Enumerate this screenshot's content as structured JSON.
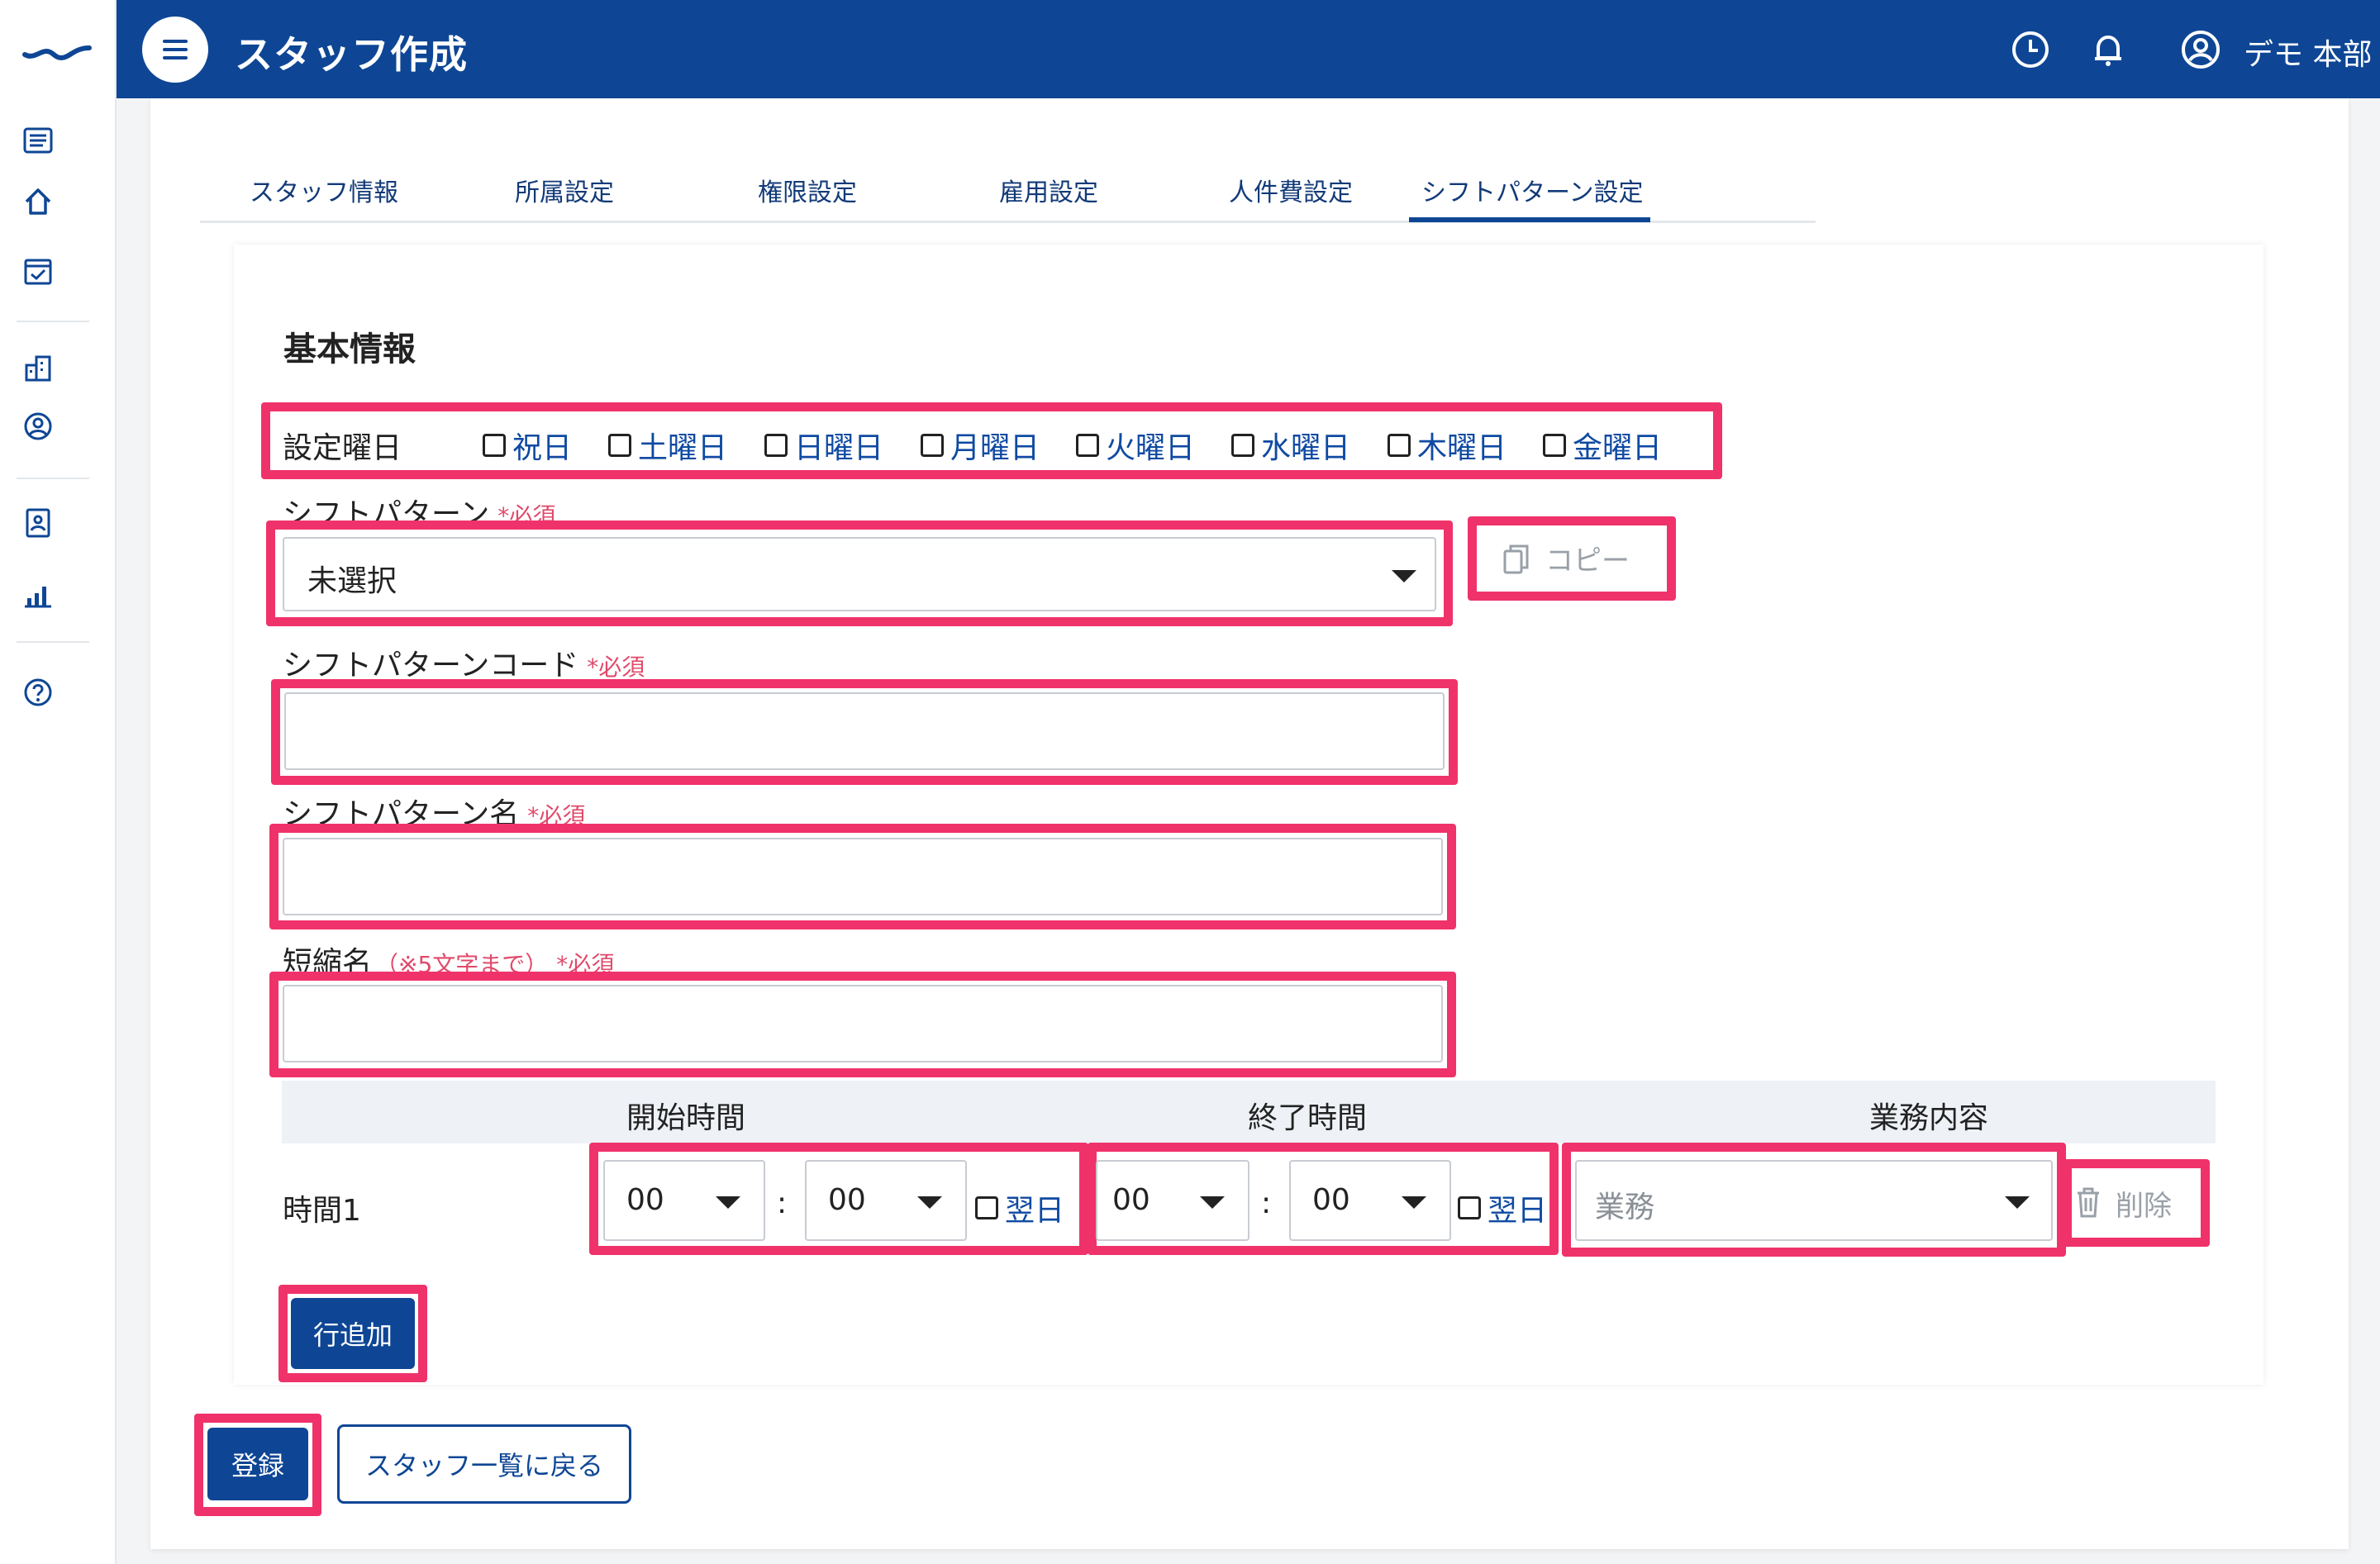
{
  "header": {
    "title": "スタッフ作成",
    "user": "デモ 本部"
  },
  "tabs": [
    {
      "label": "スタッフ情報"
    },
    {
      "label": "所属設定"
    },
    {
      "label": "権限設定"
    },
    {
      "label": "雇用設定"
    },
    {
      "label": "人件費設定"
    },
    {
      "label": "シフトパターン設定",
      "active": true
    }
  ],
  "form": {
    "section_title": "基本情報",
    "weekday_label": "設定曜日",
    "weekdays": [
      "祝日",
      "土曜日",
      "日曜日",
      "月曜日",
      "火曜日",
      "水曜日",
      "木曜日",
      "金曜日"
    ],
    "shift_pattern_label": "シフトパターン",
    "required_mark": "*必須",
    "shift_pattern_value": "未選択",
    "copy_label": "コピー",
    "shift_code_label": "シフトパターンコード",
    "shift_name_label": "シフトパターン名",
    "short_name_label": "短縮名",
    "short_name_hint": "（※5文字まで）",
    "shift_code_value": "",
    "shift_name_value": "",
    "short_name_value": ""
  },
  "table": {
    "headers": [
      "開始時間",
      "終了時間",
      "業務内容"
    ],
    "rows": [
      {
        "label": "時間1",
        "start_hour": "00",
        "start_min": "00",
        "start_next_day": "翌日",
        "end_hour": "00",
        "end_min": "00",
        "end_next_day": "翌日",
        "task_placeholder": "業務",
        "delete_label": "削除",
        "separator": ":"
      }
    ],
    "add_row_label": "行追加"
  },
  "footer": {
    "register_label": "登録",
    "back_label": "スタッフ一覧に戻る"
  },
  "colors": {
    "primary": "#0e4695",
    "highlight": "#f0326a",
    "required": "#e04a6a"
  }
}
